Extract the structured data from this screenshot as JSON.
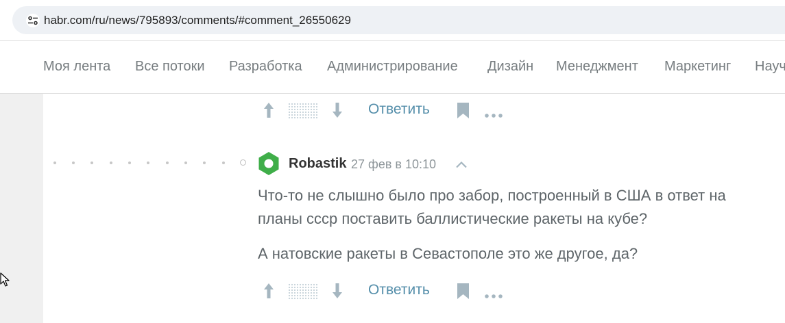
{
  "browser": {
    "url": "habr.com/ru/news/795893/comments/#comment_26550629",
    "site_icon": "tune-icon"
  },
  "nav": {
    "items": [
      {
        "label": "Моя лента"
      },
      {
        "label": "Все потоки"
      },
      {
        "label": "Разработка"
      },
      {
        "label": "Администрирование"
      },
      {
        "label": "Дизайн"
      },
      {
        "label": "Менеджмент"
      },
      {
        "label": "Маркетинг"
      },
      {
        "label": "Науч"
      }
    ]
  },
  "previous_comment": {
    "reply_label": "Ответить"
  },
  "comment": {
    "author": "Robastik",
    "time": "27 фев в 10:10",
    "paragraphs": [
      "Что-то не слышно было про забор, построенный в США в ответ на",
      "планы ссср поставить баллистические ракеты на кубе?",
      "А натовские ракеты в Севастополе это же другое, да?"
    ],
    "reply_label": "Ответить"
  },
  "colors": {
    "link": "#548eaa",
    "avatar_green": "#3fae49",
    "nav_text": "#777d80",
    "icon_gray": "#a5b6c0"
  }
}
